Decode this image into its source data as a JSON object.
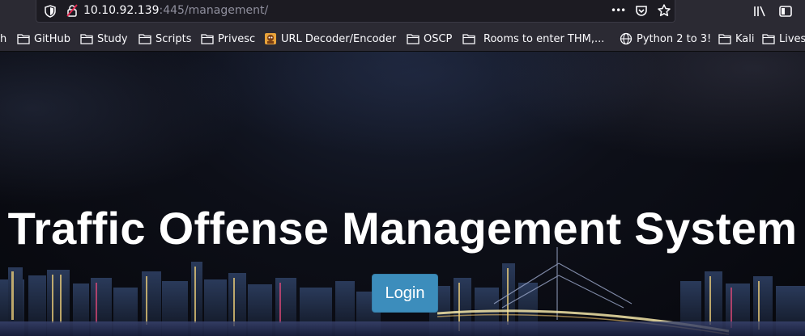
{
  "browser": {
    "url_host": "10.10.92.139",
    "url_path": ":445/management/",
    "more_label": "•••"
  },
  "bookmarks": [
    {
      "label": "h",
      "icon": "none"
    },
    {
      "label": "GitHub",
      "icon": "folder-icon"
    },
    {
      "label": "Study",
      "icon": "folder-icon"
    },
    {
      "label": "Scripts",
      "icon": "folder-icon"
    },
    {
      "label": "Privesc",
      "icon": "folder-icon"
    },
    {
      "label": "URL Decoder/Encoder",
      "icon": "favicon-icon"
    },
    {
      "label": "OSCP",
      "icon": "folder-icon"
    },
    {
      "label": "Rooms to enter THM,...",
      "icon": "folder-icon"
    },
    {
      "label": "Python 2 to 3!",
      "icon": "globe-icon"
    },
    {
      "label": "Kali",
      "icon": "folder-icon"
    },
    {
      "label": "Lives",
      "icon": "folder-icon"
    }
  ],
  "page": {
    "title": "Traffic Offense Management System",
    "login_label": "Login"
  },
  "colors": {
    "button_bg": "#3c8dbc",
    "toolbar_bg": "#2b2a33",
    "urlbar_bg": "#1c1b22"
  }
}
